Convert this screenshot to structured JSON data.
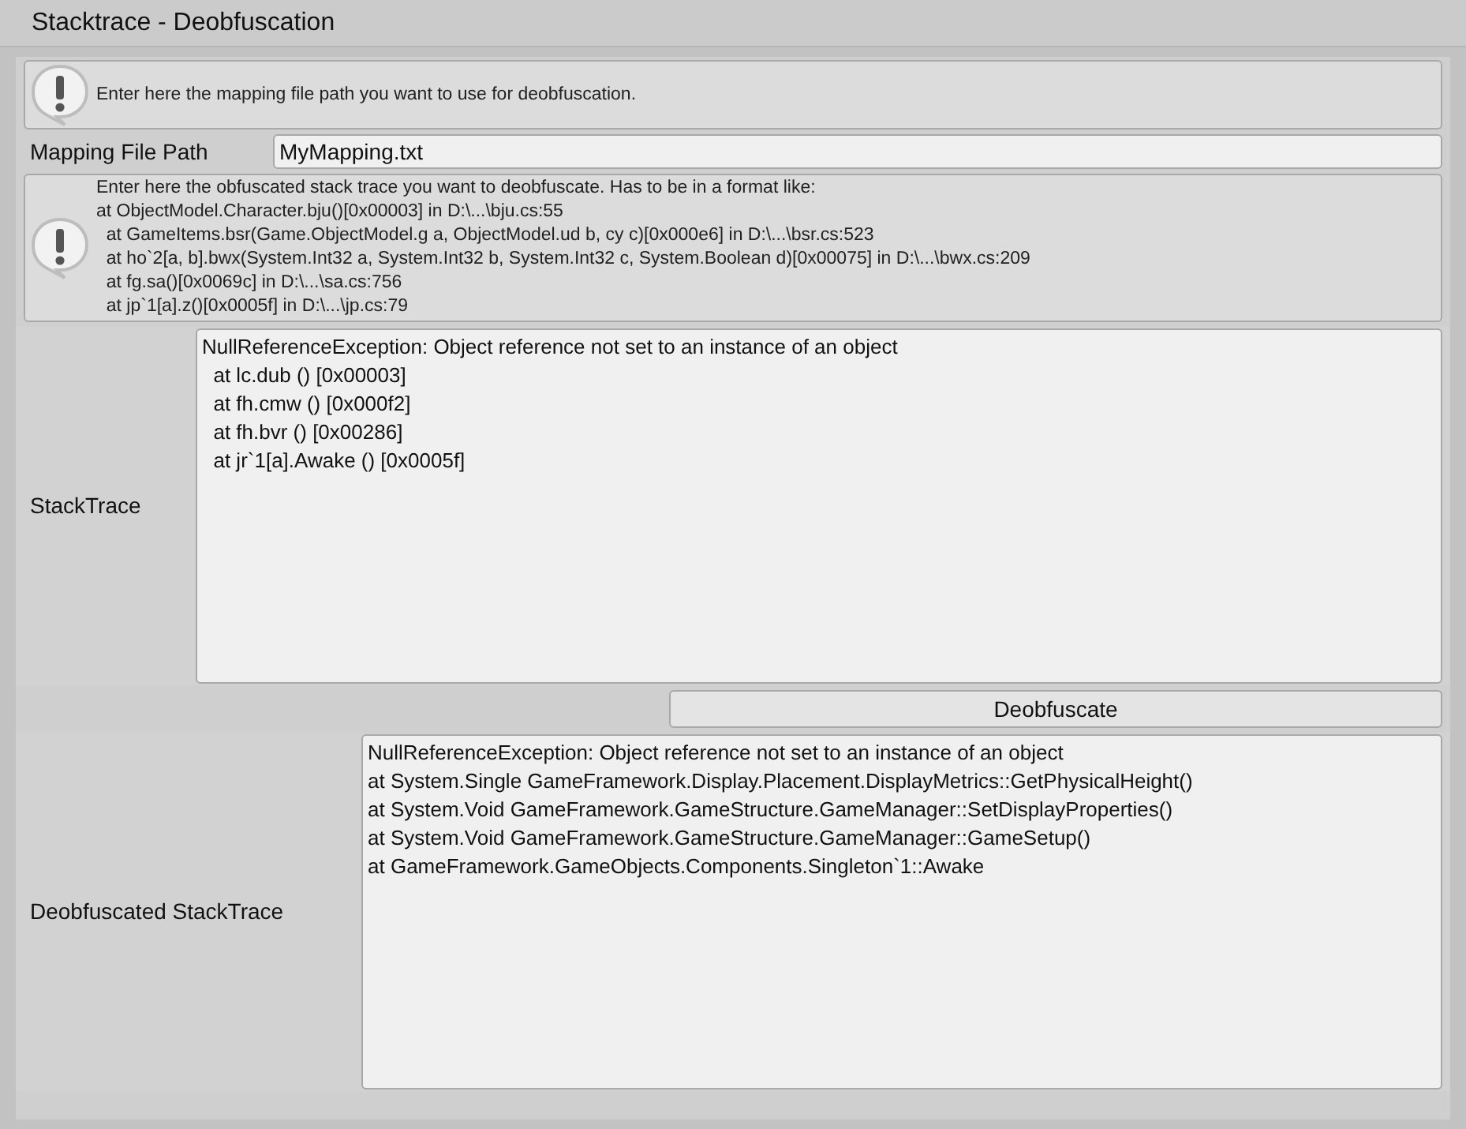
{
  "window": {
    "title": "Stacktrace - Deobfuscation"
  },
  "mapping_help": {
    "lines": [
      "Enter here the mapping file path you want to use for deobfuscation."
    ]
  },
  "mapping_field": {
    "label": "Mapping File Path",
    "value": "MyMapping.txt"
  },
  "trace_help": {
    "lines": [
      "Enter here the obfuscated stack trace you want to deobfuscate. Has to be in a format like:",
      "at ObjectModel.Character.bju()[0x00003] in D:\\...\\bju.cs:55",
      "  at GameItems.bsr(Game.ObjectModel.g a, ObjectModel.ud b, cy c)[0x000e6] in D:\\...\\bsr.cs:523",
      "  at ho`2[a, b].bwx(System.Int32 a, System.Int32 b, System.Int32 c, System.Boolean d)[0x00075] in D:\\...\\bwx.cs:209",
      "  at fg.sa()[0x0069c] in D:\\...\\sa.cs:756",
      "  at jp`1[a].z()[0x0005f] in D:\\...\\jp.cs:79"
    ]
  },
  "stacktrace": {
    "label": "StackTrace",
    "lines": [
      "NullReferenceException: Object reference not set to an instance of an object",
      "  at lc.dub () [0x00003]",
      "  at fh.cmw () [0x000f2]",
      "  at fh.bvr () [0x00286]",
      "  at jr`1[a].Awake () [0x0005f]"
    ]
  },
  "deobfuscate_button": {
    "label": "Deobfuscate"
  },
  "deobfuscated": {
    "label": "Deobfuscated StackTrace",
    "lines": [
      "NullReferenceException: Object reference not set to an instance of an object",
      "at System.Single GameFramework.Display.Placement.DisplayMetrics::GetPhysicalHeight()",
      "at System.Void GameFramework.GameStructure.GameManager::SetDisplayProperties()",
      "at System.Void GameFramework.GameStructure.GameManager::GameSetup()",
      "at GameFramework.GameObjects.Components.Singleton`1::Awake"
    ]
  }
}
